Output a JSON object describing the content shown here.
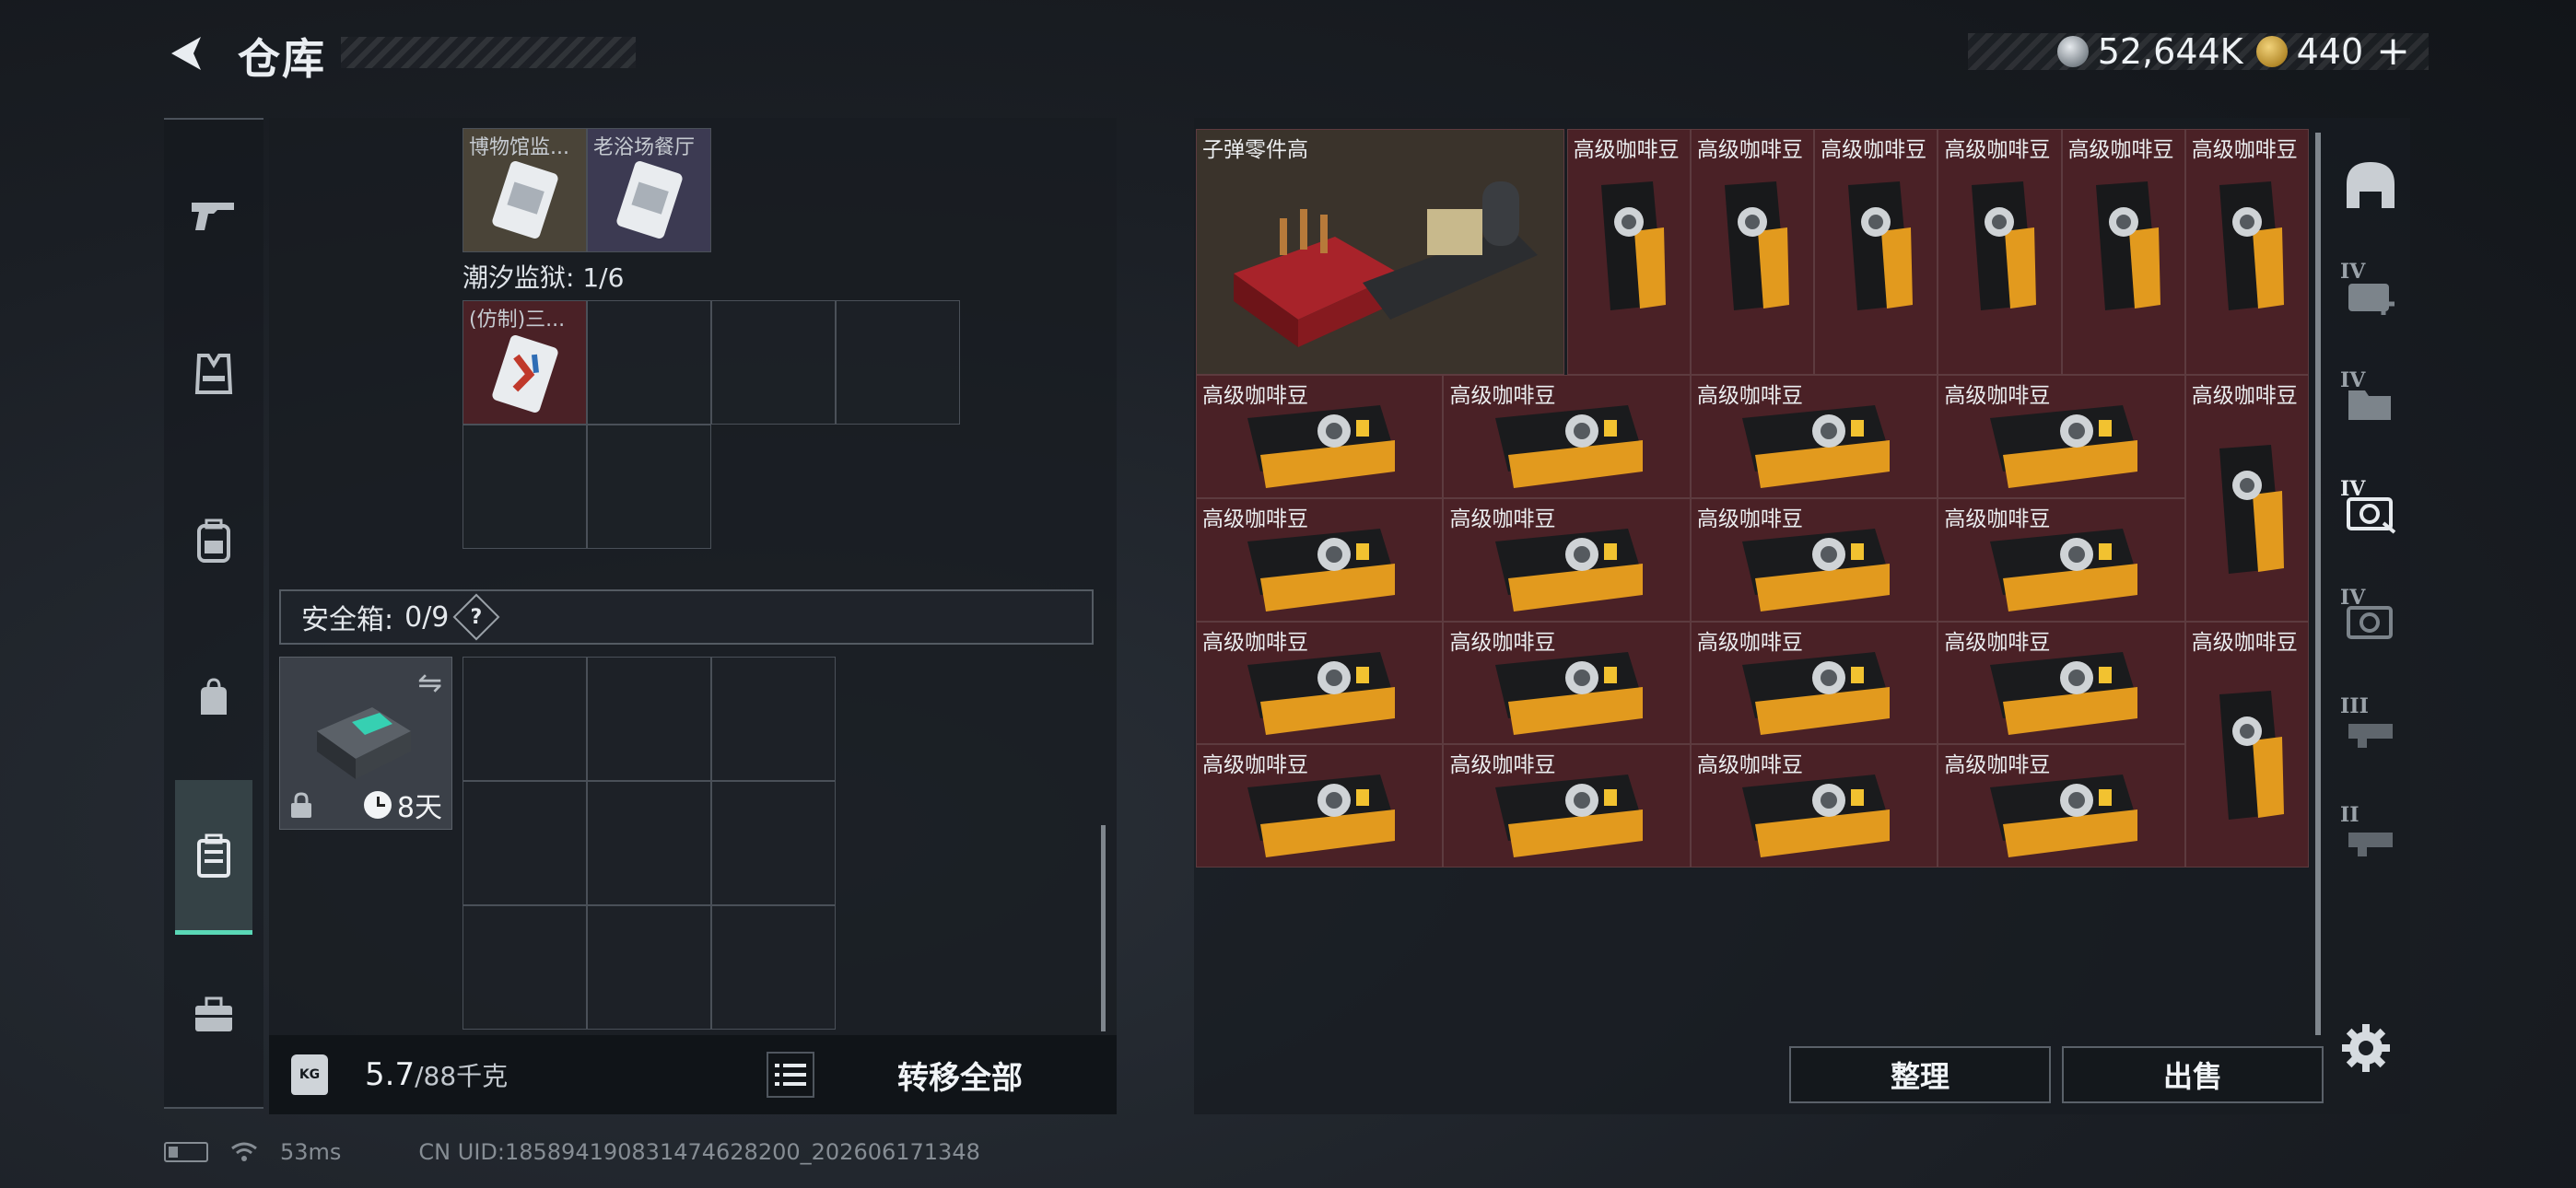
{
  "header": {
    "title": "仓库",
    "currency": {
      "silver_value": "52,644K",
      "gold_value": "440",
      "plus": "+"
    }
  },
  "left_nav": {
    "items": [
      {
        "name": "pistol-icon",
        "active": false
      },
      {
        "name": "vest-icon",
        "active": false
      },
      {
        "name": "backpack-icon",
        "active": false
      },
      {
        "name": "bag-icon",
        "active": false
      },
      {
        "name": "case-icon",
        "active": true
      },
      {
        "name": "toolbox-icon",
        "active": false
      }
    ]
  },
  "left_panel": {
    "top_items": [
      {
        "label": "博物馆监..."
      },
      {
        "label": "老浴场餐厅"
      }
    ],
    "region": {
      "label": "潮汐监狱: 1/6"
    },
    "region_item": {
      "label": "(仿制)三..."
    },
    "safebox": {
      "label": "安全箱:",
      "count": "0/9",
      "help": "?",
      "timer": "8天"
    },
    "weight": {
      "value": "5.7",
      "cap": "/88千克",
      "kg_icon": "KG"
    },
    "transfer_all": "转移全部"
  },
  "right_panel": {
    "top_item": {
      "label": "子弹零件高"
    },
    "coffee_label": "高级咖啡豆",
    "tidy_button": "整理",
    "sell_button": "出售",
    "category_nav": [
      {
        "name": "helmet-icon",
        "tier": ""
      },
      {
        "name": "medkit-icon",
        "tier": "IV"
      },
      {
        "name": "folder-icon",
        "tier": "IV"
      },
      {
        "name": "camera-icon",
        "tier": "IV"
      },
      {
        "name": "camera-icon",
        "tier": "IV"
      },
      {
        "name": "device-icon",
        "tier": "III"
      },
      {
        "name": "device-icon",
        "tier": "II"
      }
    ]
  },
  "status_bar": {
    "ping": "53ms",
    "uid": "CN UID:1858941908314746282​00_202606171348"
  }
}
